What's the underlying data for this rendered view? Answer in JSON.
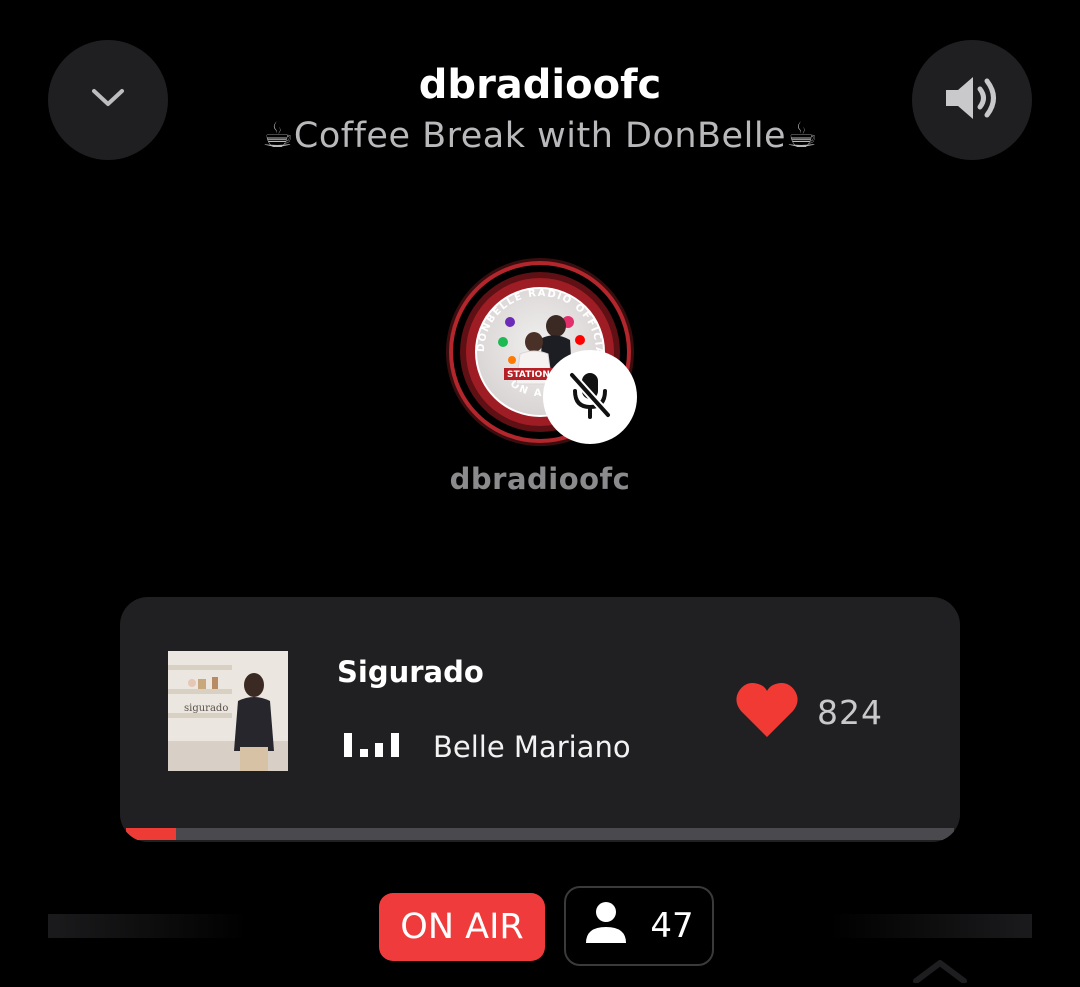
{
  "header": {
    "collapse_icon": "chevron-down-icon",
    "volume_icon": "speaker-volume-icon",
    "title": "dbradioofc",
    "subtitle": "☕Coffee Break with DonBelle☕"
  },
  "host": {
    "avatar_ring_text": "DONBELLE RADIO OFFICIAL",
    "avatar_bottom_text": "ON AIR",
    "avatar_banner_text": "STATION",
    "mic_status_icon": "mic-muted-icon",
    "name": "dbradioofc"
  },
  "now_playing": {
    "album_art_text": "sigurado",
    "title": "Sigurado",
    "artist": "Belle Mariano",
    "eq_icon": "equalizer-icon",
    "like_icon": "heart-icon",
    "likes": "824",
    "progress": 0.06
  },
  "status": {
    "on_air_label": "ON AIR",
    "listener_icon": "person-icon",
    "listeners": "47"
  },
  "colors": {
    "background": "#000000",
    "card": "#202023",
    "accent_red": "#ef3b3b",
    "heart": "#f23a35"
  }
}
